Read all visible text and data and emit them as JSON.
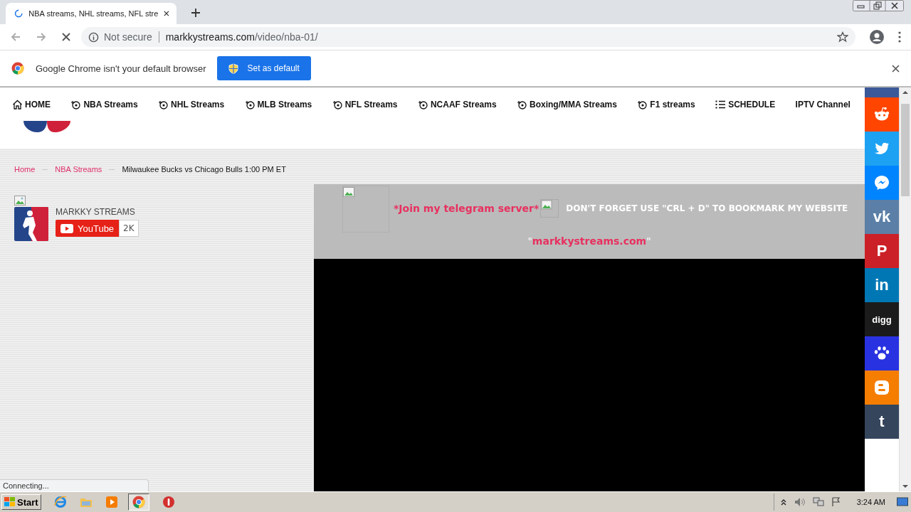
{
  "browser": {
    "tab": {
      "title": "NBA streams, NHL streams, NFL stre",
      "loading": true
    },
    "security": "Not secure",
    "url_host": "markkystreams.com",
    "url_path": "/video/nba-01/",
    "infobar": {
      "message": "Google Chrome isn't your default browser",
      "button": "Set as default"
    }
  },
  "nav": [
    {
      "label": "HOME",
      "kind": "home"
    },
    {
      "label": "NBA Streams",
      "kind": "sport"
    },
    {
      "label": "NHL Streams",
      "kind": "sport"
    },
    {
      "label": "MLB Streams",
      "kind": "sport"
    },
    {
      "label": "NFL Streams",
      "kind": "sport"
    },
    {
      "label": "NCAAF Streams",
      "kind": "sport"
    },
    {
      "label": "Boxing/MMA Streams",
      "kind": "sport"
    },
    {
      "label": "F1 streams",
      "kind": "sport"
    },
    {
      "label": "SCHEDULE",
      "kind": "list"
    },
    {
      "label": "IPTV Channel",
      "kind": "plain"
    }
  ],
  "breadcrumb": [
    {
      "label": "Home",
      "kind": "link"
    },
    {
      "label": "NBA Streams",
      "kind": "link"
    },
    {
      "label": "Milwaukee Bucks vs Chicago Bulls 1:00 PM ET",
      "kind": "current"
    }
  ],
  "channel": {
    "name": "MARKKY STREAMS",
    "button": "YouTube",
    "count": "2K"
  },
  "video": {
    "telegram": "*Join my telegram server*",
    "notice": "DON'T FORGET USE \"CRL + D\" TO BOOKMARK MY WEBSITE",
    "quote_open": "\"",
    "site": "markkystreams.com",
    "quote_close": "\""
  },
  "share": [
    {
      "kind": "reddit",
      "color": "#ff4500"
    },
    {
      "kind": "twitter",
      "color": "#1da1f2"
    },
    {
      "kind": "messenger",
      "color": "#0084ff"
    },
    {
      "kind": "text",
      "label": "vk",
      "color": "#5b7fa6"
    },
    {
      "kind": "text",
      "label": "P",
      "color": "#cb2027"
    },
    {
      "kind": "text",
      "label": "in",
      "color": "#0077b5"
    },
    {
      "kind": "text",
      "label": "digg",
      "color": "#1b1b1b"
    },
    {
      "kind": "paw",
      "color": "#2932e1"
    },
    {
      "kind": "blogger",
      "color": "#f57d00"
    },
    {
      "kind": "text",
      "label": "t",
      "color": "#35465c"
    }
  ],
  "status": "Connecting...",
  "taskbar": {
    "start": "Start",
    "time": "3:24 AM"
  }
}
